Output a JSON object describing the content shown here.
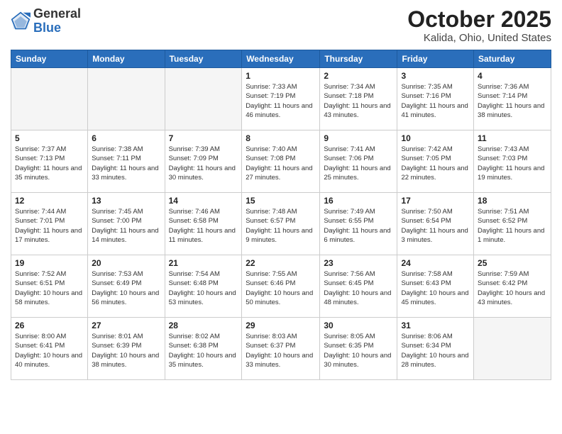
{
  "logo": {
    "general": "General",
    "blue": "Blue"
  },
  "title": "October 2025",
  "location": "Kalida, Ohio, United States",
  "weekdays": [
    "Sunday",
    "Monday",
    "Tuesday",
    "Wednesday",
    "Thursday",
    "Friday",
    "Saturday"
  ],
  "weeks": [
    [
      {
        "day": "",
        "empty": true
      },
      {
        "day": "",
        "empty": true
      },
      {
        "day": "",
        "empty": true
      },
      {
        "day": "1",
        "sunrise": "Sunrise: 7:33 AM",
        "sunset": "Sunset: 7:19 PM",
        "daylight": "Daylight: 11 hours and 46 minutes."
      },
      {
        "day": "2",
        "sunrise": "Sunrise: 7:34 AM",
        "sunset": "Sunset: 7:18 PM",
        "daylight": "Daylight: 11 hours and 43 minutes."
      },
      {
        "day": "3",
        "sunrise": "Sunrise: 7:35 AM",
        "sunset": "Sunset: 7:16 PM",
        "daylight": "Daylight: 11 hours and 41 minutes."
      },
      {
        "day": "4",
        "sunrise": "Sunrise: 7:36 AM",
        "sunset": "Sunset: 7:14 PM",
        "daylight": "Daylight: 11 hours and 38 minutes."
      }
    ],
    [
      {
        "day": "5",
        "sunrise": "Sunrise: 7:37 AM",
        "sunset": "Sunset: 7:13 PM",
        "daylight": "Daylight: 11 hours and 35 minutes."
      },
      {
        "day": "6",
        "sunrise": "Sunrise: 7:38 AM",
        "sunset": "Sunset: 7:11 PM",
        "daylight": "Daylight: 11 hours and 33 minutes."
      },
      {
        "day": "7",
        "sunrise": "Sunrise: 7:39 AM",
        "sunset": "Sunset: 7:09 PM",
        "daylight": "Daylight: 11 hours and 30 minutes."
      },
      {
        "day": "8",
        "sunrise": "Sunrise: 7:40 AM",
        "sunset": "Sunset: 7:08 PM",
        "daylight": "Daylight: 11 hours and 27 minutes."
      },
      {
        "day": "9",
        "sunrise": "Sunrise: 7:41 AM",
        "sunset": "Sunset: 7:06 PM",
        "daylight": "Daylight: 11 hours and 25 minutes."
      },
      {
        "day": "10",
        "sunrise": "Sunrise: 7:42 AM",
        "sunset": "Sunset: 7:05 PM",
        "daylight": "Daylight: 11 hours and 22 minutes."
      },
      {
        "day": "11",
        "sunrise": "Sunrise: 7:43 AM",
        "sunset": "Sunset: 7:03 PM",
        "daylight": "Daylight: 11 hours and 19 minutes."
      }
    ],
    [
      {
        "day": "12",
        "sunrise": "Sunrise: 7:44 AM",
        "sunset": "Sunset: 7:01 PM",
        "daylight": "Daylight: 11 hours and 17 minutes."
      },
      {
        "day": "13",
        "sunrise": "Sunrise: 7:45 AM",
        "sunset": "Sunset: 7:00 PM",
        "daylight": "Daylight: 11 hours and 14 minutes."
      },
      {
        "day": "14",
        "sunrise": "Sunrise: 7:46 AM",
        "sunset": "Sunset: 6:58 PM",
        "daylight": "Daylight: 11 hours and 11 minutes."
      },
      {
        "day": "15",
        "sunrise": "Sunrise: 7:48 AM",
        "sunset": "Sunset: 6:57 PM",
        "daylight": "Daylight: 11 hours and 9 minutes."
      },
      {
        "day": "16",
        "sunrise": "Sunrise: 7:49 AM",
        "sunset": "Sunset: 6:55 PM",
        "daylight": "Daylight: 11 hours and 6 minutes."
      },
      {
        "day": "17",
        "sunrise": "Sunrise: 7:50 AM",
        "sunset": "Sunset: 6:54 PM",
        "daylight": "Daylight: 11 hours and 3 minutes."
      },
      {
        "day": "18",
        "sunrise": "Sunrise: 7:51 AM",
        "sunset": "Sunset: 6:52 PM",
        "daylight": "Daylight: 11 hours and 1 minute."
      }
    ],
    [
      {
        "day": "19",
        "sunrise": "Sunrise: 7:52 AM",
        "sunset": "Sunset: 6:51 PM",
        "daylight": "Daylight: 10 hours and 58 minutes."
      },
      {
        "day": "20",
        "sunrise": "Sunrise: 7:53 AM",
        "sunset": "Sunset: 6:49 PM",
        "daylight": "Daylight: 10 hours and 56 minutes."
      },
      {
        "day": "21",
        "sunrise": "Sunrise: 7:54 AM",
        "sunset": "Sunset: 6:48 PM",
        "daylight": "Daylight: 10 hours and 53 minutes."
      },
      {
        "day": "22",
        "sunrise": "Sunrise: 7:55 AM",
        "sunset": "Sunset: 6:46 PM",
        "daylight": "Daylight: 10 hours and 50 minutes."
      },
      {
        "day": "23",
        "sunrise": "Sunrise: 7:56 AM",
        "sunset": "Sunset: 6:45 PM",
        "daylight": "Daylight: 10 hours and 48 minutes."
      },
      {
        "day": "24",
        "sunrise": "Sunrise: 7:58 AM",
        "sunset": "Sunset: 6:43 PM",
        "daylight": "Daylight: 10 hours and 45 minutes."
      },
      {
        "day": "25",
        "sunrise": "Sunrise: 7:59 AM",
        "sunset": "Sunset: 6:42 PM",
        "daylight": "Daylight: 10 hours and 43 minutes."
      }
    ],
    [
      {
        "day": "26",
        "sunrise": "Sunrise: 8:00 AM",
        "sunset": "Sunset: 6:41 PM",
        "daylight": "Daylight: 10 hours and 40 minutes."
      },
      {
        "day": "27",
        "sunrise": "Sunrise: 8:01 AM",
        "sunset": "Sunset: 6:39 PM",
        "daylight": "Daylight: 10 hours and 38 minutes."
      },
      {
        "day": "28",
        "sunrise": "Sunrise: 8:02 AM",
        "sunset": "Sunset: 6:38 PM",
        "daylight": "Daylight: 10 hours and 35 minutes."
      },
      {
        "day": "29",
        "sunrise": "Sunrise: 8:03 AM",
        "sunset": "Sunset: 6:37 PM",
        "daylight": "Daylight: 10 hours and 33 minutes."
      },
      {
        "day": "30",
        "sunrise": "Sunrise: 8:05 AM",
        "sunset": "Sunset: 6:35 PM",
        "daylight": "Daylight: 10 hours and 30 minutes."
      },
      {
        "day": "31",
        "sunrise": "Sunrise: 8:06 AM",
        "sunset": "Sunset: 6:34 PM",
        "daylight": "Daylight: 10 hours and 28 minutes."
      },
      {
        "day": "",
        "empty": true
      }
    ]
  ]
}
